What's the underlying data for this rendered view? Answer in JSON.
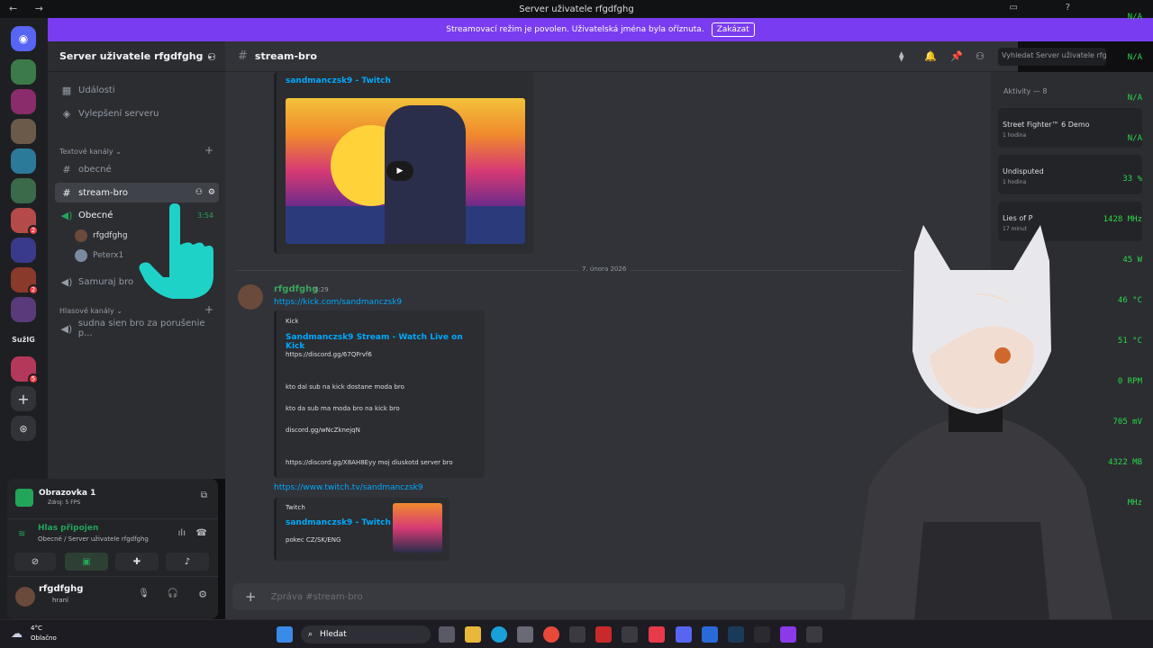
{
  "window": {
    "title": "Server uživatele rfgdfghg"
  },
  "banner": {
    "text": "Streamovací režim je povolen. Uživatelská jména byla oříznuta.",
    "button": "Zakázat"
  },
  "server": {
    "name": "Server uživatele rfgdfghg",
    "menu": [
      {
        "label": "Události"
      },
      {
        "label": "Vylepšení serveru"
      }
    ],
    "text_category": "Textové kanály",
    "text_channels": [
      {
        "label": "obecné"
      },
      {
        "label": "stream-bro"
      }
    ],
    "voice_active": {
      "label": "Obecné",
      "time": "3:54",
      "users": [
        "rfgdfghg",
        "Peterx1"
      ]
    },
    "other_channel": "Samuraj bro",
    "voice_category": "Hlasové kanály",
    "voice_channel": "sudna sien bro za porušenie p..."
  },
  "rail": {
    "label": "SužIG"
  },
  "panel": {
    "screen_title": "Obrazovka 1",
    "screen_sub": "Zdroj: 5 FPS",
    "voice_status": "Hlas připojen",
    "voice_path": "Obecné / Server uživatele rfgdfghg",
    "user_name": "rfgdfghg",
    "user_status": "hraní"
  },
  "chat": {
    "channel": "stream-bro",
    "search": "Vyhledat Server uživatele rfgdfghg",
    "embed_top_title": "sandmanczsk9 - Twitch",
    "date_divider": "7. února 2026",
    "author": "rfgdfghg",
    "time": "5:29",
    "link1": "https://kick.com/sandmanczsk9",
    "kick_provider": "Kick",
    "kick_title": "Sandmanczsk9 Stream - Watch Live on Kick",
    "kick_lines": [
      "https://discord.gg/67QFrvf6",
      "kto dal sub na kick dostane moda bro",
      "kto da sub ma moda bro na kick bro",
      "discord.gg/wNcZknejqN",
      "https://discord.gg/X8AH8Eyy moj diuskotd server bro"
    ],
    "link2": "https://www.twitch.tv/sandmanczsk9",
    "twitch_provider": "Twitch",
    "twitch_title": "sandmanczsk9 - Twitch",
    "twitch_desc": "pokec CZ/SK/ENG",
    "composer_placeholder": "Zpráva #stream-bro"
  },
  "members": {
    "header": "Aktivity — 8",
    "items": [
      {
        "game": "Street Fighter™ 6 Demo",
        "sub": "1 hodina"
      },
      {
        "game": "Undisputed",
        "sub": "1 hodina"
      },
      {
        "game": "Lies of P",
        "sub": "17 minut"
      }
    ]
  },
  "stats": [
    "N/A",
    "N/A",
    "N/A",
    "N/A",
    "33 %",
    "1428 MHz",
    "45 W",
    "46 °C",
    "51 °C",
    "0 RPM",
    "705 mV",
    "4322 MB",
    "MHz"
  ],
  "taskbar": {
    "weather_temp": "4°C",
    "weather_text": "Oblačno",
    "search": "Hledat"
  },
  "colors": {
    "accent": "#5865f2",
    "banner": "#7a3cf0",
    "online": "#23a55a",
    "link": "#00a8fc",
    "author": "#3ba55c"
  }
}
